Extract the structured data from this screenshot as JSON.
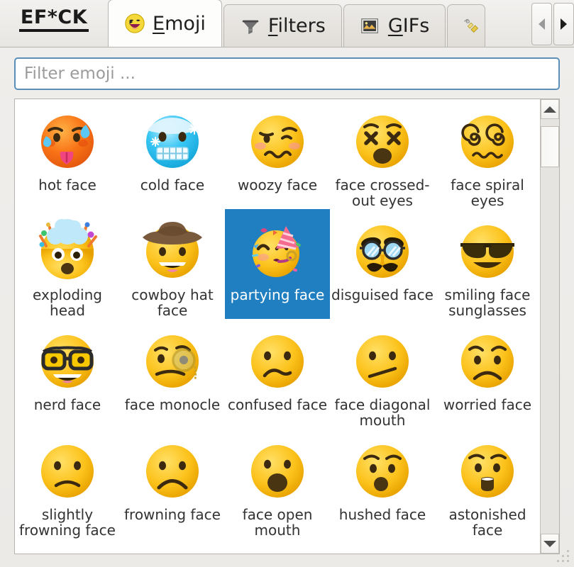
{
  "window": {
    "brand": "EF*CK"
  },
  "tabbar": {
    "tabs": [
      {
        "label": "Emoji",
        "accel": "E",
        "icon": "grinning-face-icon",
        "active": true
      },
      {
        "label": "Filters",
        "accel": "F",
        "icon": "filter-funnel-icon",
        "active": false
      },
      {
        "label": "GIFs",
        "accel": "G",
        "icon": "image-picture-icon",
        "active": false
      },
      {
        "label": "",
        "accel": "",
        "icon": "magic-wand-icon",
        "active": false
      }
    ],
    "nav": {
      "prev_label": "◀",
      "next_label": "▶",
      "prev_name": "scroll-tabs-left",
      "next_name": "scroll-tabs-right"
    }
  },
  "search": {
    "placeholder": "Filter emoji ...",
    "value": ""
  },
  "grid": {
    "columns": 5,
    "selected_index": 7,
    "selection_color": "#1f7fc0",
    "items": [
      {
        "name": "hot face",
        "glyph": "hot-face"
      },
      {
        "name": "cold face",
        "glyph": "cold-face"
      },
      {
        "name": "woozy face",
        "glyph": "woozy-face"
      },
      {
        "name": "face crossed-out eyes",
        "glyph": "face-crossed-out-eyes"
      },
      {
        "name": "face spiral eyes",
        "glyph": "face-spiral-eyes"
      },
      {
        "name": "exploding head",
        "glyph": "exploding-head"
      },
      {
        "name": "cowboy hat face",
        "glyph": "cowboy-hat-face"
      },
      {
        "name": "partying face",
        "glyph": "partying-face"
      },
      {
        "name": "disguised face",
        "glyph": "disguised-face"
      },
      {
        "name": "smiling face sunglasses",
        "glyph": "smiling-face-sunglasses"
      },
      {
        "name": "nerd face",
        "glyph": "nerd-face"
      },
      {
        "name": "face monocle",
        "glyph": "face-monocle"
      },
      {
        "name": "confused face",
        "glyph": "confused-face"
      },
      {
        "name": "face diagonal mouth",
        "glyph": "face-diagonal-mouth"
      },
      {
        "name": "worried face",
        "glyph": "worried-face"
      },
      {
        "name": "slightly frowning face",
        "glyph": "slightly-frowning-face"
      },
      {
        "name": "frowning face",
        "glyph": "frowning-face"
      },
      {
        "name": "face open mouth",
        "glyph": "face-open-mouth"
      },
      {
        "name": "hushed face",
        "glyph": "hushed-face"
      },
      {
        "name": "astonished face",
        "glyph": "astonished-face"
      }
    ]
  },
  "scrollbar": {
    "up_name": "scroll-up-button",
    "down_name": "scroll-down-button",
    "thumb_name": "scroll-thumb"
  }
}
